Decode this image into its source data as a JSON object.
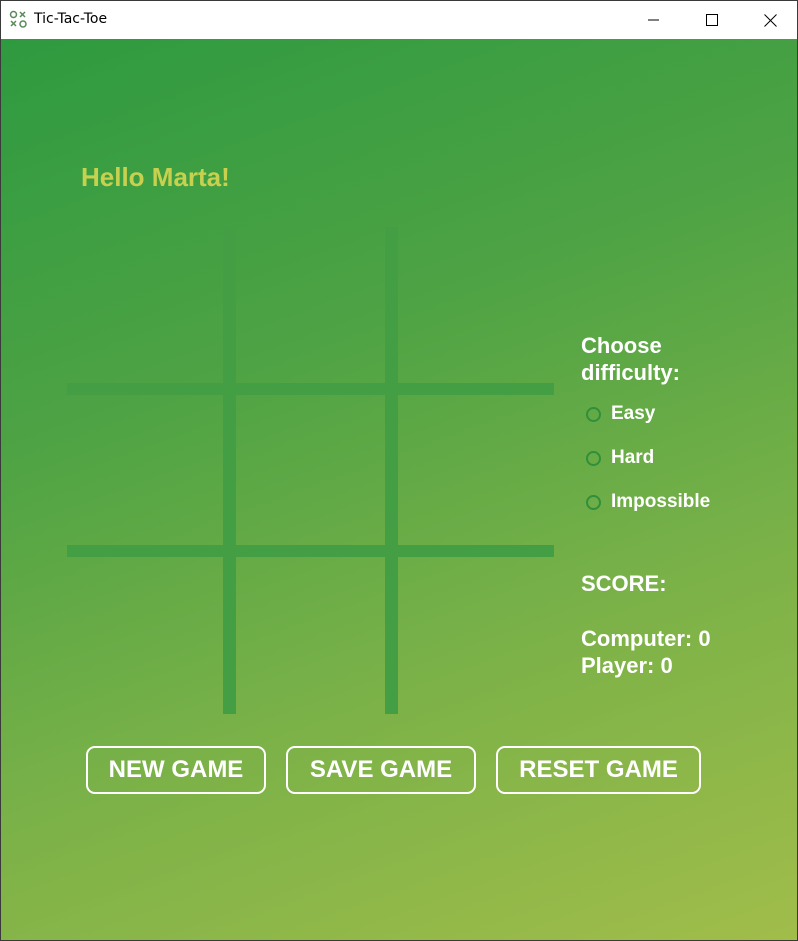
{
  "window": {
    "title": "Tic-Tac-Toe",
    "icon": "tic-tac-toe-app-icon",
    "controls": [
      "minimize-icon",
      "maximize-icon",
      "close-icon"
    ]
  },
  "greeting": "Hello Marta!",
  "board": {
    "cells": [
      "",
      "",
      "",
      "",
      "",
      "",
      "",
      "",
      ""
    ]
  },
  "difficulty": {
    "title": "Choose difficulty:",
    "options": [
      "Easy",
      "Hard",
      "Impossible"
    ],
    "selected": null
  },
  "score": {
    "title": "SCORE:",
    "computer_label": "Computer: 0",
    "player_label": "Player: 0"
  },
  "buttons": {
    "new_game": "NEW GAME",
    "save_game": "SAVE GAME",
    "reset_game": "RESET GAME"
  },
  "colors": {
    "background_top": "#2e9a40",
    "background_bottom": "#a1bd4a",
    "grid_lines": "#449e43",
    "greeting": "#c7d14f",
    "text": "#ffffff"
  }
}
